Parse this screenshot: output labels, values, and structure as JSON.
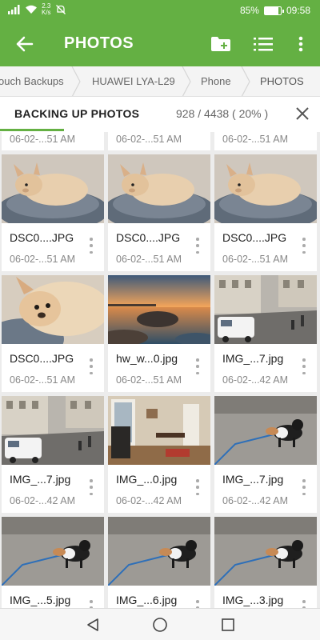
{
  "status_bar": {
    "speed_value": "2.3",
    "speed_unit": "K/s",
    "battery": "85%",
    "battery_level": 0.85,
    "time": "09:58"
  },
  "app_bar": {
    "title": "PHOTOS",
    "icons": [
      "back-arrow-icon",
      "new-folder-icon",
      "list-view-icon",
      "more-vert-icon"
    ]
  },
  "breadcrumb": {
    "items": [
      "ouch Backups",
      "HUAWEI LYA-L29",
      "Phone",
      "PHOTOS"
    ]
  },
  "progress": {
    "title": "BACKING UP PHOTOS",
    "count": "928 / 4438 ( 20% )",
    "fraction": 0.2
  },
  "top_row_dates": [
    "06-02-...51 AM",
    "06-02-...51 AM",
    "06-02-...51 AM"
  ],
  "files": [
    {
      "name": "DSC0....JPG",
      "date": "06-02-...51 AM",
      "thumb": "dog-bed"
    },
    {
      "name": "DSC0....JPG",
      "date": "06-02-...51 AM",
      "thumb": "dog-bed"
    },
    {
      "name": "DSC0....JPG",
      "date": "06-02-...51 AM",
      "thumb": "dog-bed"
    },
    {
      "name": "DSC0....JPG",
      "date": "06-02-...51 AM",
      "thumb": "dog-closeup"
    },
    {
      "name": "hw_w...0.jpg",
      "date": "06-02-...51 AM",
      "thumb": "seascape"
    },
    {
      "name": "IMG_...7.jpg",
      "date": "06-02-...42 AM",
      "thumb": "street"
    },
    {
      "name": "IMG_...7.jpg",
      "date": "06-02-...42 AM",
      "thumb": "street"
    },
    {
      "name": "IMG_...0.jpg",
      "date": "06-02-...42 AM",
      "thumb": "room"
    },
    {
      "name": "IMG_...7.jpg",
      "date": "06-02-...42 AM",
      "thumb": "dog-walk"
    },
    {
      "name": "IMG_...5.jpg",
      "date": "",
      "thumb": "dog-walk"
    },
    {
      "name": "IMG_...6.jpg",
      "date": "",
      "thumb": "dog-walk"
    },
    {
      "name": "IMG_...3.jpg",
      "date": "",
      "thumb": "dog-walk"
    }
  ],
  "nav_bar": {
    "icons": [
      "back-triangle-icon",
      "home-circle-icon",
      "recents-square-icon"
    ]
  },
  "colors": {
    "accent": "#64b043"
  }
}
